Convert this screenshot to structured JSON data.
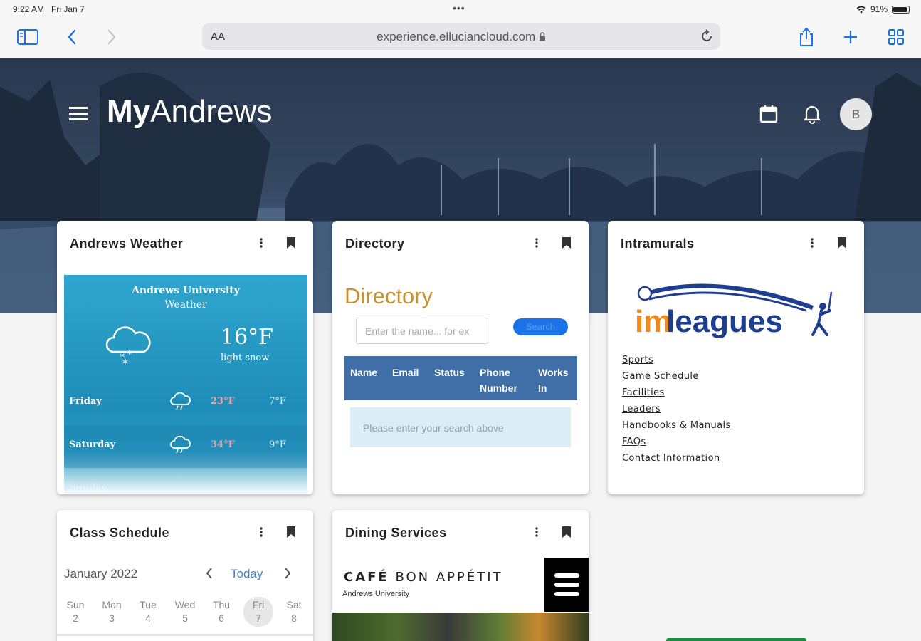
{
  "status_bar": {
    "time": "9:22 AM",
    "date": "Fri Jan 7",
    "battery": "91%"
  },
  "browser": {
    "text_size_label": "AA",
    "url": "experience.elluciancloud.com"
  },
  "header": {
    "brand_bold": "My",
    "brand_rest": "Andrews",
    "avatar_initial": "B"
  },
  "cards": {
    "weather": {
      "title": "Andrews Weather",
      "heading": "Andrews University",
      "subheading": "Weather",
      "temperature": "16°F",
      "condition": "light snow",
      "forecast": [
        {
          "day": "Friday",
          "high": "23°F",
          "low": "7°F"
        },
        {
          "day": "Saturday",
          "high": "34°F",
          "low": "9°F"
        },
        {
          "day": "Sunday"
        }
      ]
    },
    "directory": {
      "title": "Directory",
      "heading": "Directory",
      "search_placeholder": "Enter the name... for ex",
      "search_button": "Search",
      "columns": [
        "Name",
        "Email",
        "Status",
        "Phone Number",
        "Works In"
      ],
      "empty_message": "Please enter your search above"
    },
    "intramurals": {
      "title": "Intramurals",
      "logo_text_im": "im",
      "logo_text_rest": "leagues",
      "links": [
        "Sports",
        "Game Schedule",
        "Facilities",
        "Leaders",
        "Handbooks & Manuals",
        "FAQs",
        "Contact Information"
      ]
    },
    "class_schedule": {
      "title": "Class Schedule",
      "month": "January 2022",
      "today_label": "Today",
      "days": [
        {
          "name": "Sun",
          "num": "2"
        },
        {
          "name": "Mon",
          "num": "3"
        },
        {
          "name": "Tue",
          "num": "4"
        },
        {
          "name": "Wed",
          "num": "5"
        },
        {
          "name": "Thu",
          "num": "6"
        },
        {
          "name": "Fri",
          "num": "7"
        },
        {
          "name": "Sat",
          "num": "8"
        }
      ]
    },
    "dining": {
      "title": "Dining Services",
      "cafe_bold": "CAFÉ",
      "cafe_rest": " BON APPÉTIT",
      "cafe_sub": "Andrews University"
    }
  },
  "colors": {
    "accent_blue": "#1a73e8",
    "table_header": "#3f6fa6",
    "directory_heading": "#c9922e",
    "weather_bg": "#2fa6cf"
  }
}
